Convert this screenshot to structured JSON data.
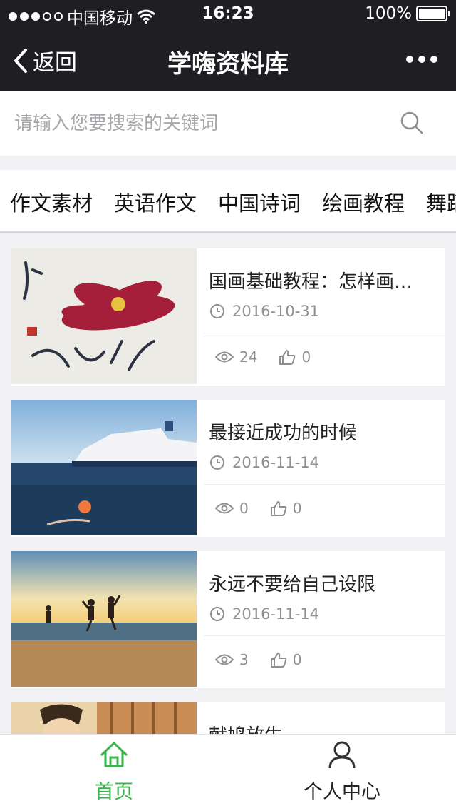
{
  "status_bar": {
    "carrier": "中国移动",
    "time": "16:23",
    "battery": "100%",
    "battery_level": 1.0
  },
  "nav": {
    "back_label": "返回",
    "title": "学嗨资料库"
  },
  "search": {
    "placeholder": "请输入您要搜索的关键词"
  },
  "categories": [
    "作文素材",
    "英语作文",
    "中国诗词",
    "绘画教程",
    "舞蹈"
  ],
  "articles": [
    {
      "title": "国画基础教程：怎样画牡丹",
      "date": "2016-10-31",
      "views": "24",
      "likes": "0",
      "thumb": "peony-painting"
    },
    {
      "title": "最接近成功的时候",
      "date": "2016-11-14",
      "views": "0",
      "likes": "0",
      "thumb": "ferry-swimmer"
    },
    {
      "title": "永远不要给自己设限",
      "date": "2016-11-14",
      "views": "3",
      "likes": "0",
      "thumb": "beach-jumpers"
    },
    {
      "title": "献鸠放生",
      "thumb": "ancient-scholar"
    }
  ],
  "tabs": [
    {
      "label": "首页",
      "icon": "home-icon",
      "active": true
    },
    {
      "label": "个人中心",
      "icon": "user-icon",
      "active": false
    }
  ],
  "colors": {
    "nav_bg": "#1f1f23",
    "active_tab": "#3ab54a",
    "page_bg": "#f2f2f4"
  }
}
